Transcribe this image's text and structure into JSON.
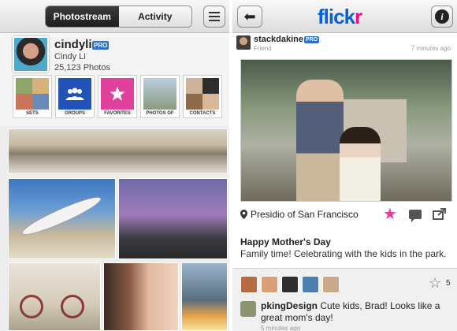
{
  "left": {
    "tabs": [
      "Photostream",
      "Activity"
    ],
    "profile": {
      "username": "cindyli",
      "badge": "PRO",
      "realname": "Cindy Li",
      "photo_count": "25,123 Photos"
    },
    "tiles": [
      "SETS",
      "GROUPS",
      "FAVORITES",
      "PHOTOS OF",
      "CONTACTS"
    ]
  },
  "right": {
    "logo": {
      "part1": "flick",
      "part2": "r"
    },
    "info_glyph": "i",
    "poster": {
      "name": "stackdakine",
      "badge": "PRO",
      "relation": "Friend",
      "time": "7 minutes ago"
    },
    "location": "Presidio of San Francisco",
    "caption_title": "Happy Mother's Day",
    "caption_text": "Family time! Celebrating with the kids in the park.",
    "fav_count": "5",
    "comment": {
      "user": "pkingDesign",
      "text": "Cute kids, Brad! Looks like a great mom's day!",
      "time": "5 minutes ago"
    }
  },
  "colors": {
    "flickr_blue": "#0063dc",
    "flickr_pink": "#ff0084",
    "pro_badge": "#2c74c9"
  }
}
